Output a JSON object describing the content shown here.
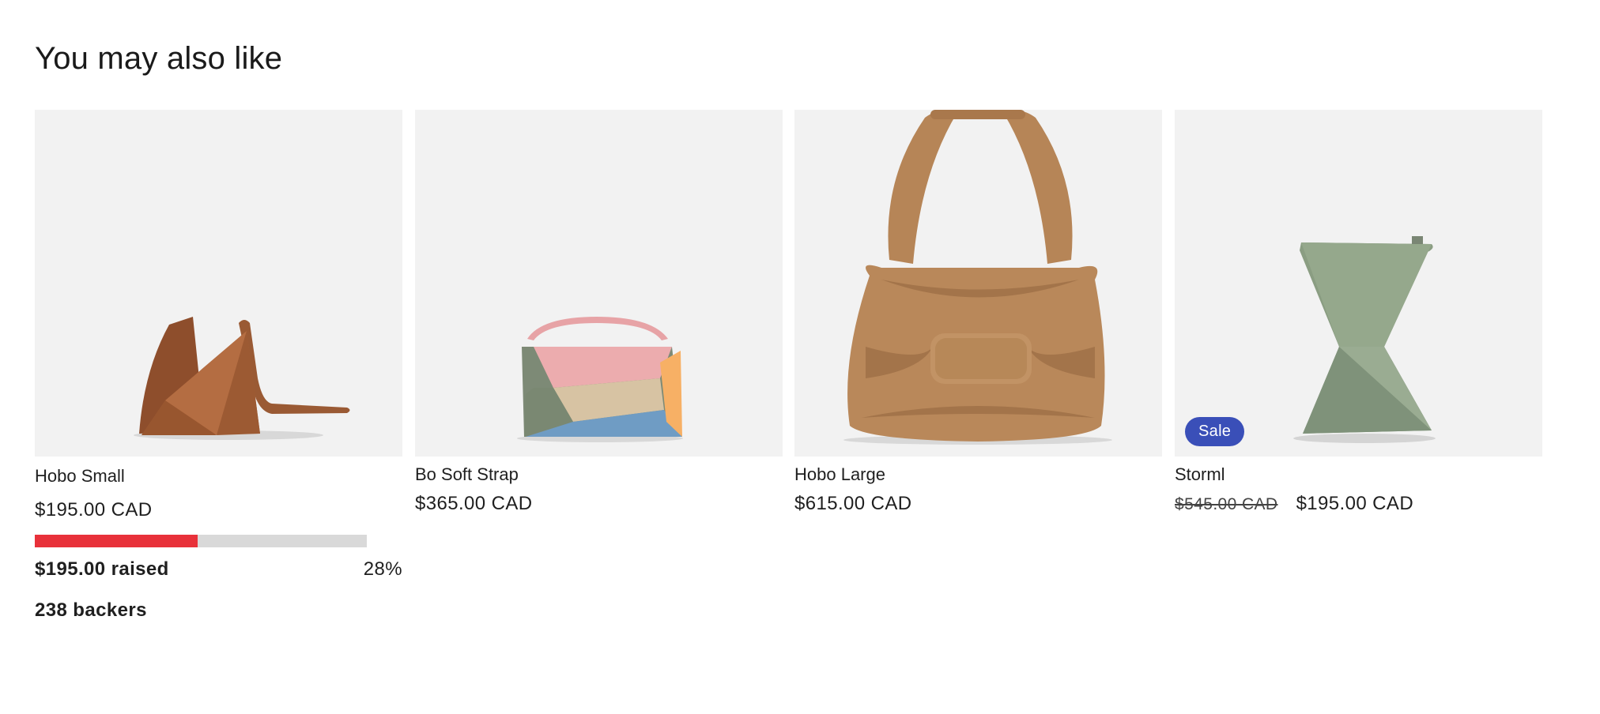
{
  "section": {
    "title": "You may also like"
  },
  "products": [
    {
      "title": "Hobo Small",
      "price": "$195.00 CAD",
      "image_icon": "brown-triangular-bag-image",
      "campaign": {
        "raised": "$195.00 raised",
        "percent_label": "28%",
        "percent": 28,
        "backers": "238 backers",
        "fill_color": "#e8313a",
        "track_color": "#d9d9d9"
      }
    },
    {
      "title": "Bo Soft Strap",
      "price": "$365.00 CAD",
      "image_icon": "colorblock-handbag-image"
    },
    {
      "title": "Hobo Large",
      "price": "$615.00 CAD",
      "image_icon": "puffy-tan-bag-image"
    },
    {
      "title": "Storml",
      "compare_price": "$545.00 CAD",
      "price": "$195.00 CAD",
      "badge": "Sale",
      "badge_color": "#3a4fb8",
      "image_icon": "green-twisted-bag-image"
    }
  ]
}
